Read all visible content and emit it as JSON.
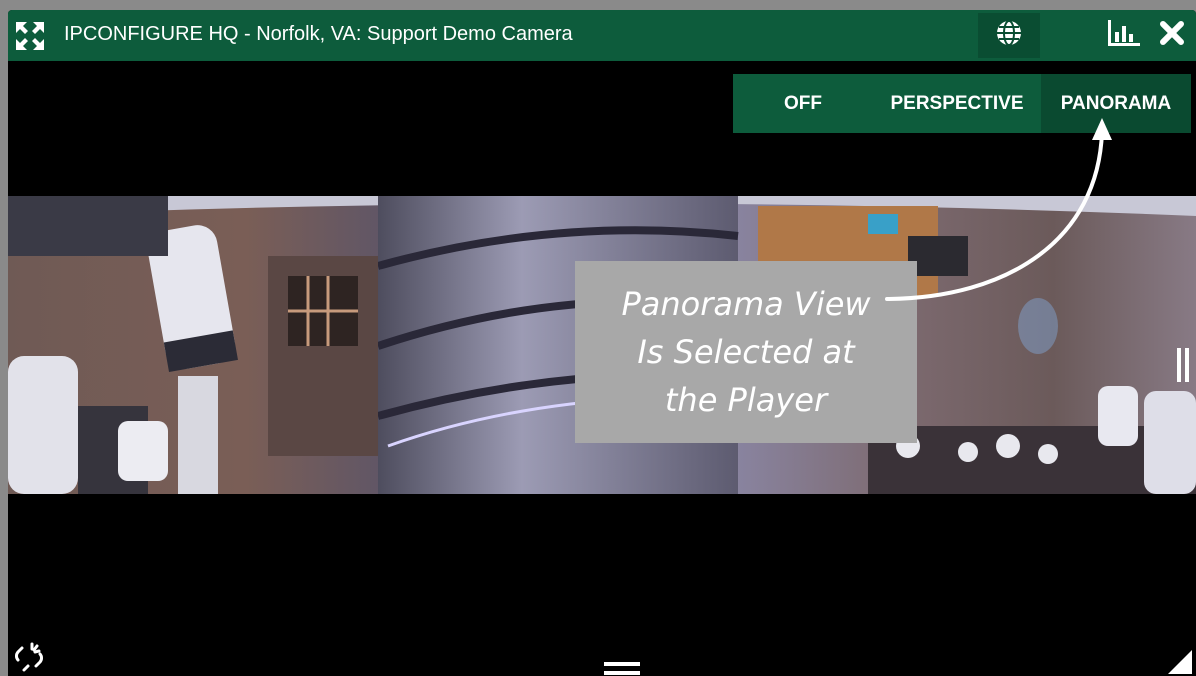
{
  "window": {
    "title": "IPCONFIGURE HQ - Norfolk, VA: Support Demo Camera"
  },
  "titlebar_icons": [
    "expand-arrows-icon",
    "globe-icon",
    "bar-chart-icon",
    "close-icon"
  ],
  "view_modes": {
    "off": "OFF",
    "perspective": "PERSPECTIVE",
    "panorama": "PANORAMA",
    "selected": "PANORAMA"
  },
  "callout": {
    "line1": "Panorama View",
    "line2": "Is Selected at",
    "line3": "the Player"
  },
  "colors": {
    "titlebar": "#0d5c3c",
    "selected_mode": "#0a4a30",
    "callout_bg": "#a8a8a8"
  }
}
